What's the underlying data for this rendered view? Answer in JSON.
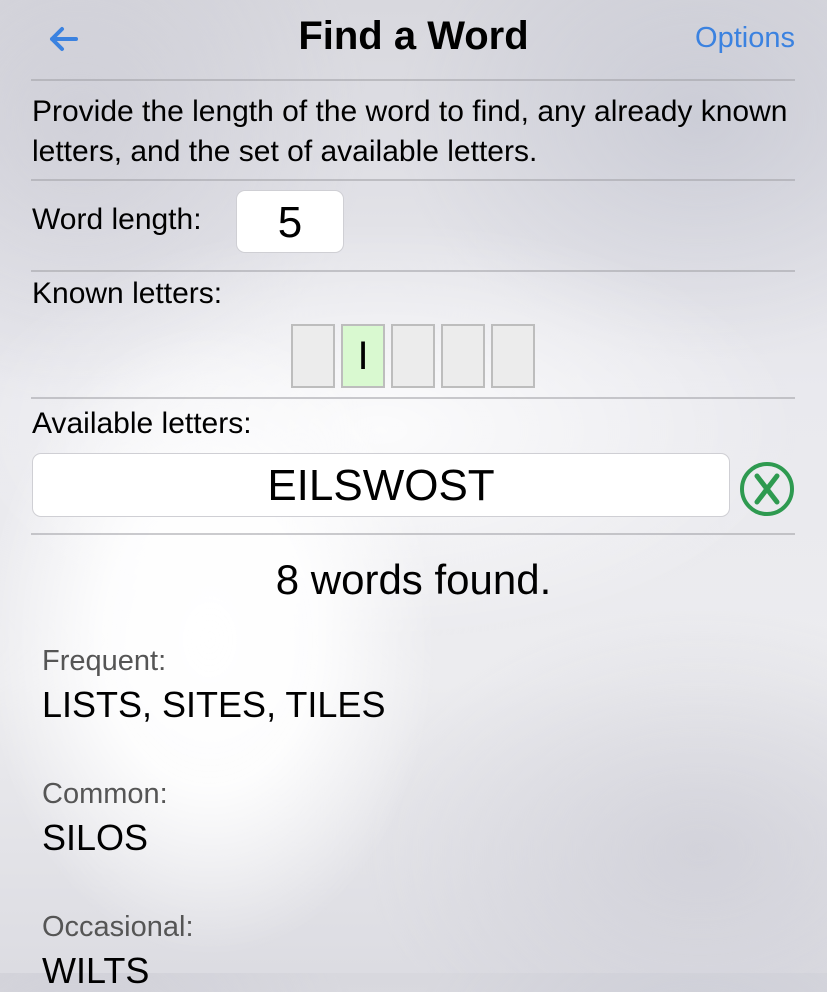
{
  "header": {
    "back_icon": "left-arrow-icon",
    "title": "Find a Word",
    "options_label": "Options",
    "accent_color": "#3b82e0"
  },
  "description": "Provide the length of the word to find, any already known letters, and the set of available letters.",
  "word_length": {
    "label": "Word length:",
    "value": "5"
  },
  "known_letters": {
    "label": "Known letters:",
    "slots": [
      "",
      "I",
      "",
      "",
      ""
    ]
  },
  "available_letters": {
    "label": "Available letters:",
    "value": "EILSWOST",
    "clear_icon": "clear-x-circle-icon",
    "clear_color": "#2e9a50"
  },
  "results": {
    "count_text": "8 words found.",
    "groups": [
      {
        "category": "Frequent:",
        "words": "LISTS, SITES, TILES"
      },
      {
        "category": "Common:",
        "words": "SILOS"
      },
      {
        "category": "Occasional:",
        "words": "WILTS"
      }
    ]
  }
}
